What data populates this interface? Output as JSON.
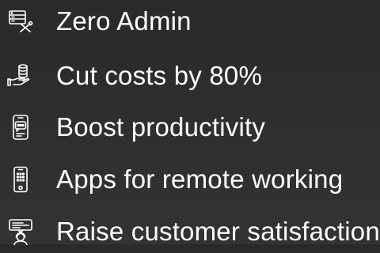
{
  "features": [
    {
      "label": "Zero Admin",
      "icon": "server-tools-icon"
    },
    {
      "label": "Cut costs by 80%",
      "icon": "coins-hand-icon"
    },
    {
      "label": "Boost productivity",
      "icon": "phone-chat-icon"
    },
    {
      "label": "Apps for remote working",
      "icon": "mobile-apps-icon"
    },
    {
      "label": "Raise customer satisfaction",
      "icon": "customer-support-icon"
    }
  ],
  "colors": {
    "text": "#ffffff",
    "icon_stroke": "#ffffff",
    "background_top": "#2a2a2a",
    "background_bottom": "#333333"
  }
}
